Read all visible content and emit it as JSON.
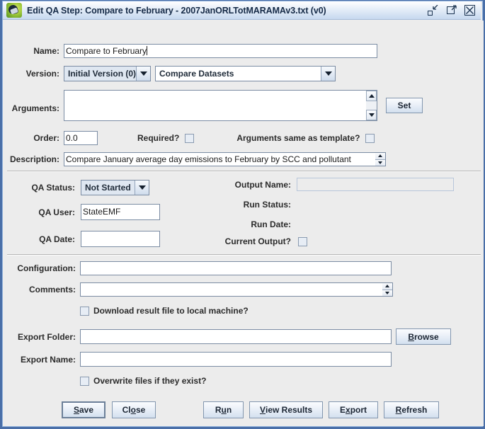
{
  "window": {
    "title": "Edit QA Step: Compare to February - 2007JanORLTotMARAMAv3.txt (v0)",
    "icon": "app-icon",
    "buttons": {
      "minimize": "Minimize",
      "maximize": "Maximize",
      "close": "Close"
    }
  },
  "form": {
    "name": {
      "label": "Name:",
      "value": "Compare to February"
    },
    "version": {
      "label": "Version:",
      "value": "Initial Version (0)",
      "program_value": "Compare Datasets"
    },
    "arguments": {
      "label": "Arguments:",
      "value": "",
      "set_button": "Set"
    },
    "order": {
      "label": "Order:",
      "value": "0.0"
    },
    "required": {
      "label": "Required?",
      "checked": false
    },
    "args_same_as_template": {
      "label": "Arguments same as template?",
      "checked": false
    },
    "description": {
      "label": "Description:",
      "value": "Compare January average day emissions to February by SCC and pollutant"
    }
  },
  "qa": {
    "status": {
      "label": "QA Status:",
      "value": "Not Started"
    },
    "user": {
      "label": "QA User:",
      "value": "StateEMF"
    },
    "date": {
      "label": "QA Date:",
      "value": ""
    },
    "output_name": {
      "label": "Output Name:",
      "value": ""
    },
    "run_status": {
      "label": "Run Status:",
      "value": ""
    },
    "run_date": {
      "label": "Run Date:",
      "value": ""
    },
    "current_output": {
      "label": "Current Output?",
      "checked": false
    }
  },
  "details": {
    "configuration": {
      "label": "Configuration:",
      "value": ""
    },
    "comments": {
      "label": "Comments:",
      "value": ""
    },
    "download_result": {
      "label": "Download result file to local machine?",
      "checked": false
    },
    "export_folder": {
      "label": "Export Folder:",
      "value": "",
      "browse_button": "Browse",
      "browse_mnemonic": "B"
    },
    "export_name": {
      "label": "Export Name:",
      "value": ""
    },
    "overwrite": {
      "label": "Overwrite files if they exist?",
      "checked": false
    }
  },
  "actions": {
    "save": {
      "pre": "",
      "mn": "S",
      "post": "ave"
    },
    "close": {
      "pre": "Cl",
      "mn": "o",
      "post": "se"
    },
    "run": {
      "pre": "R",
      "mn": "u",
      "post": "n"
    },
    "view_results": {
      "pre": "",
      "mn": "V",
      "post": "iew Results"
    },
    "export": {
      "pre": "E",
      "mn": "x",
      "post": "port"
    },
    "refresh": {
      "pre": "",
      "mn": "R",
      "post": "efresh"
    }
  },
  "colors": {
    "frame_border": "#4a6fa8",
    "panel_bg": "#ececec",
    "field_border": "#7b8ca3",
    "combo_tint": "#dfe7f1",
    "title_text": "#152a47"
  }
}
